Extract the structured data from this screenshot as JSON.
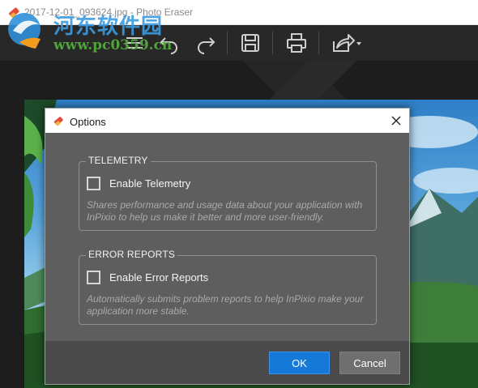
{
  "window": {
    "title": "2017-12-01_093624.jpg - Photo Eraser"
  },
  "watermark": {
    "site_name": "河东软件园",
    "url": "www.pc0359.cn"
  },
  "toolbar": {
    "items": [
      "menu-icon",
      "undo-icon",
      "redo-icon",
      "save-icon",
      "print-icon",
      "share-icon"
    ]
  },
  "dialog": {
    "title": "Options",
    "telemetry": {
      "heading": "TELEMETRY",
      "checkbox_label": "Enable Telemetry",
      "checked": false,
      "description": "Shares performance and usage data about your application with InPixio to help us make it better and more user-friendly."
    },
    "error_reports": {
      "heading": "ERROR REPORTS",
      "checkbox_label": "Enable Error Reports",
      "checked": false,
      "description": "Automatically submits problem reports to help InPixio make your application more stable."
    },
    "ok_label": "OK",
    "cancel_label": "Cancel"
  },
  "colors": {
    "ok_button": "#1479d7",
    "dialog_bg": "#5e5e5e",
    "toolbar_bg": "#282828"
  }
}
